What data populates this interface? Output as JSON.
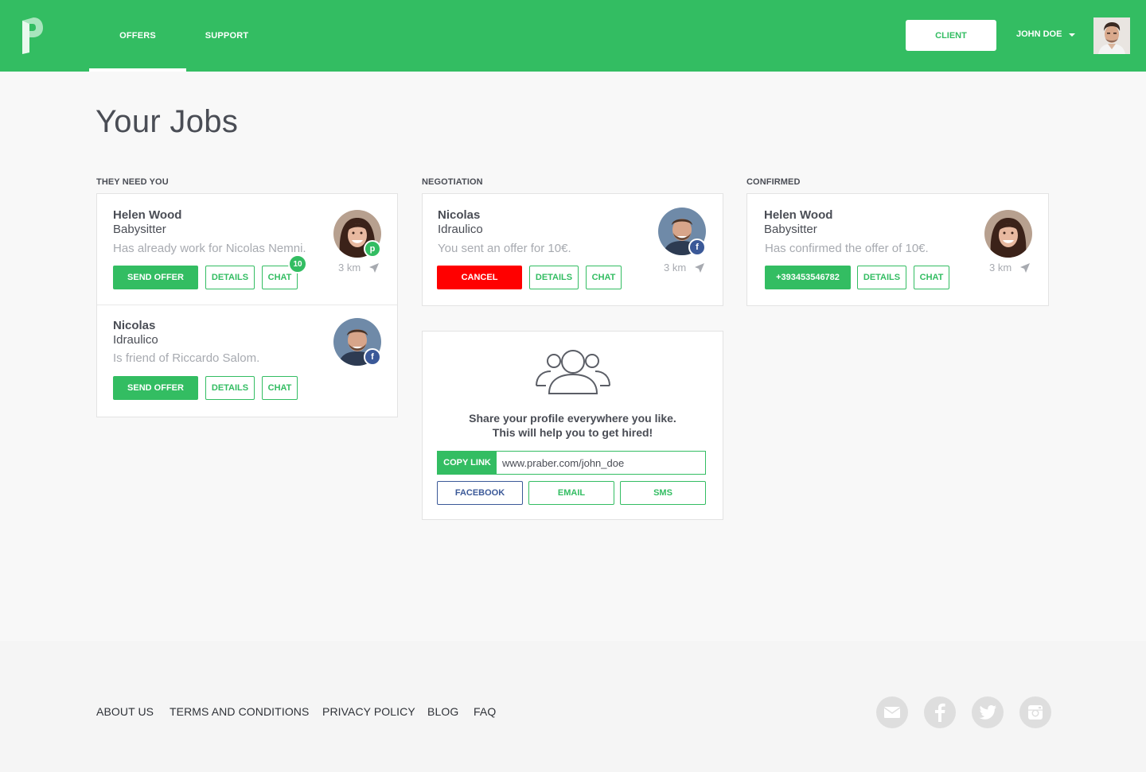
{
  "colors": {
    "brand_green": "#33bd62",
    "cancel_red": "#ff0000",
    "facebook_blue": "#3b5998"
  },
  "header": {
    "nav": [
      {
        "label": "OFFERS"
      },
      {
        "label": "SUPPORT"
      }
    ],
    "active_tab": "OFFERS",
    "client_button": "CLIENT",
    "user_name": "JOHN DOE"
  },
  "page": {
    "title": "Your Jobs"
  },
  "columns": {
    "need": {
      "label": "THEY NEED YOU",
      "jobs": [
        {
          "name": "Helen Wood",
          "role": "Babysitter",
          "note": "Has already work for Nicolas Nemni.",
          "distance": "3 km",
          "badge": "p",
          "buttons": {
            "primary": "SEND OFFER",
            "details": "DETAILS",
            "chat": "CHAT"
          },
          "chat_count": "10"
        },
        {
          "name": "Nicolas",
          "role": "Idraulico",
          "note": "Is friend of Riccardo Salom.",
          "badge": "f",
          "buttons": {
            "primary": "SEND OFFER",
            "details": "DETAILS",
            "chat": "CHAT"
          }
        }
      ]
    },
    "negotiation": {
      "label": "NEGOTIATION",
      "jobs": [
        {
          "name": "Nicolas",
          "role": "Idraulico",
          "note": "You sent an offer for 10€.",
          "distance": "3 km",
          "badge": "f",
          "buttons": {
            "primary": "CANCEL",
            "details": "DETAILS",
            "chat": "CHAT"
          }
        }
      ]
    },
    "confirmed": {
      "label": "CONFIRMED",
      "jobs": [
        {
          "name": "Helen Wood",
          "role": "Babysitter",
          "note": "Has confirmed the offer of 10€.",
          "distance": "3 km",
          "buttons": {
            "primary": "+393453546782",
            "details": "DETAILS",
            "chat": "CHAT"
          }
        }
      ]
    }
  },
  "share": {
    "line1": "Share your profile everywhere you like.",
    "line2": "This will help you to get hired!",
    "copy_label": "COPY LINK",
    "link": "www.praber.com/john_doe",
    "buttons": {
      "facebook": "FACEBOOK",
      "email": "EMAIL",
      "sms": "SMS"
    }
  },
  "footer": {
    "links": [
      {
        "label": "ABOUT US"
      },
      {
        "label": "TERMS AND CONDITIONS"
      },
      {
        "label": "PRIVACY POLICY"
      },
      {
        "label": "BLOG"
      },
      {
        "label": "FAQ"
      }
    ],
    "social_icons": [
      "mail-icon",
      "facebook-icon",
      "twitter-icon",
      "instagram-icon"
    ]
  }
}
